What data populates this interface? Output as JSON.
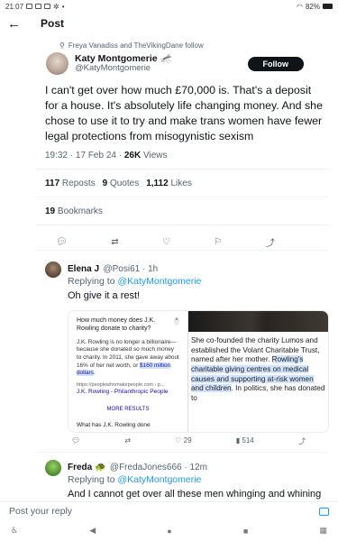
{
  "status_bar": {
    "time": "21:07",
    "battery": "82%"
  },
  "header": {
    "back_icon": "arrow-left-icon",
    "title": "Post"
  },
  "main_tweet": {
    "social_context": "Freya Vanadiss and TheVikingDane follow",
    "author_name": "Katy Montgomerie 🦟",
    "author_handle": "@KatyMontgomerie",
    "follow_label": "Follow",
    "text": "I can't get over how much £70,000 is. That's a deposit for a house. It's absolutely life changing money. And she chose to use it to try and make trans women have fewer legal protections from misogynistic sexism",
    "time": "19:32 · 17 Feb 24 · ",
    "views_count": "26K",
    "views_label": " Views",
    "reposts_count": "117",
    "reposts_label": "Reposts",
    "quotes_count": "9",
    "quotes_label": "Quotes",
    "likes_count": "1,112",
    "likes_label": "Likes",
    "bookmarks_count": "19",
    "bookmarks_label": "Bookmarks"
  },
  "replies": [
    {
      "name": "Elena J",
      "handle": "@Posi61 · 1h",
      "replying_prefix": "Replying to ",
      "replying_to": "@KatyMontgomerie",
      "text": "Oh give it a rest!",
      "image1": {
        "question": "How much money does J.K. Rowling donate to charity?",
        "caret": "^",
        "body_pre": "J.K. Rowling is no longer a billionaire—because she donated so much money to charity. In 2011, she gave away about 16% of her net worth, or ",
        "body_hl": "$160 million dollars",
        "body_post": ".",
        "source_url": "https://peoplewhomakepeople.com › p...",
        "source_name": "J.K. Rowling - Philanthropic People",
        "more": "MORE RESULTS",
        "question2": "What has J.K. Rowling done"
      },
      "image2": {
        "pre": "She co-founded the charity Lumos and established the Volant Charitable Trust, named after her mother. ",
        "hl": "Rowling's charitable giving centres on medical causes and supporting at-risk women and children",
        "post": ". In politics, she has donated to"
      },
      "likes": "29",
      "views": "514"
    },
    {
      "name": "Freda 🐢",
      "handle": "@FredaJones666 · 12m",
      "replying_prefix": "Replying to ",
      "replying_to": "@KatyMontgomerie",
      "text": "And I cannot get over all these men whinging and whining that a woman is spending money as she chooses."
    }
  ],
  "reply_bar": {
    "placeholder": "Post your reply"
  },
  "colors": {
    "accent": "#1d9bf0",
    "text": "#0f1419",
    "muted": "#536471"
  }
}
